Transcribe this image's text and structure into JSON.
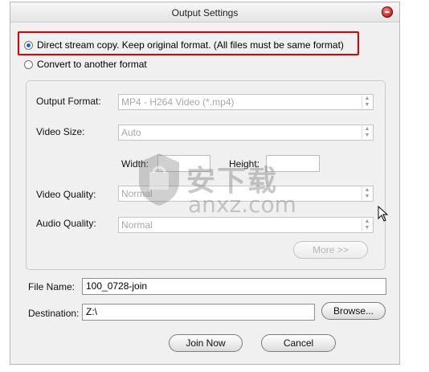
{
  "window": {
    "title": "Output Settings"
  },
  "mode": {
    "direct_copy_label": "Direct stream copy. Keep original format. (All files must be same format)",
    "convert_label": "Convert to another format",
    "selected": "direct_copy"
  },
  "format": {
    "output_format_label": "Output Format:",
    "output_format_value": "MP4 - H264 Video (*.mp4)",
    "video_size_label": "Video Size:",
    "video_size_value": "Auto",
    "width_label": "Width:",
    "width_value": "",
    "height_label": "Height:",
    "height_value": "",
    "video_quality_label": "Video Quality:",
    "video_quality_value": "Normal",
    "audio_quality_label": "Audio Quality:",
    "audio_quality_value": "Normal",
    "more_label": "More >>"
  },
  "output": {
    "file_name_label": "File Name:",
    "file_name_value": "100_0728-join",
    "destination_label": "Destination:",
    "destination_value": "Z:\\",
    "browse_label": "Browse..."
  },
  "actions": {
    "join_label": "Join Now",
    "cancel_label": "Cancel"
  },
  "watermark": {
    "cn_text": "安下载",
    "url_text": "anxz.com"
  },
  "colors": {
    "highlight": "#e00000",
    "radio_accent": "#1f66c9",
    "close_button": "#c01e1e"
  },
  "icons": {
    "close": "close-icon",
    "spinner": "spinner-arrows-icon",
    "cursor": "mouse-pointer-icon",
    "watermark": "shield-bag-icon"
  }
}
